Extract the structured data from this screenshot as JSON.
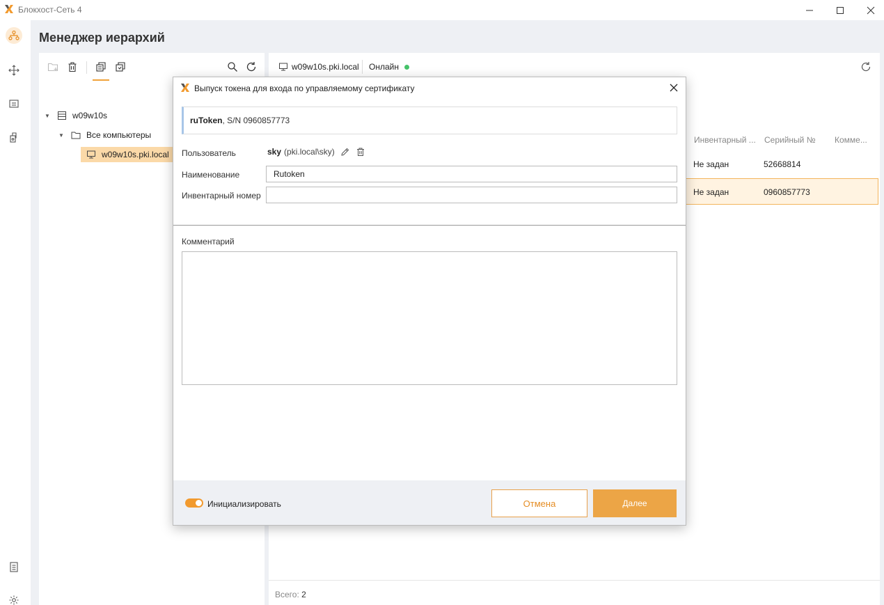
{
  "app": {
    "title": "Блокхост-Сеть 4"
  },
  "page": {
    "title": "Менеджер иерархий"
  },
  "tree": {
    "root": "w09w10s",
    "group": "Все компьютеры",
    "host": "w09w10s.pki.local"
  },
  "right": {
    "host": "w09w10s.pki.local",
    "status": "Онлайн",
    "columns": [
      "Инвентарный ...",
      "Серийный №",
      "Комме..."
    ],
    "rows": [
      {
        "inventory": "Не задан",
        "serial": "52668814"
      },
      {
        "inventory": "Не задан",
        "serial": "0960857773"
      }
    ],
    "total_label": "Всего:",
    "total_value": "2"
  },
  "dialog": {
    "title": "Выпуск токена для входа по управляемому сертификату",
    "token_name": "ruToken",
    "token_sn": ", S/N 0960857773",
    "user_label": "Пользователь",
    "user_name": "sky",
    "user_domain": "(pki.local\\sky)",
    "name_label": "Наименование",
    "name_value": "Rutoken",
    "inventory_label": "Инвентарный номер",
    "inventory_value": "",
    "comment_label": "Комментарий",
    "comment_value": "",
    "init_label": "Инициализировать",
    "init_enabled": true,
    "cancel_label": "Отмена",
    "next_label": "Далее"
  },
  "colors": {
    "accent": "#eca546",
    "online": "#46c36a"
  }
}
